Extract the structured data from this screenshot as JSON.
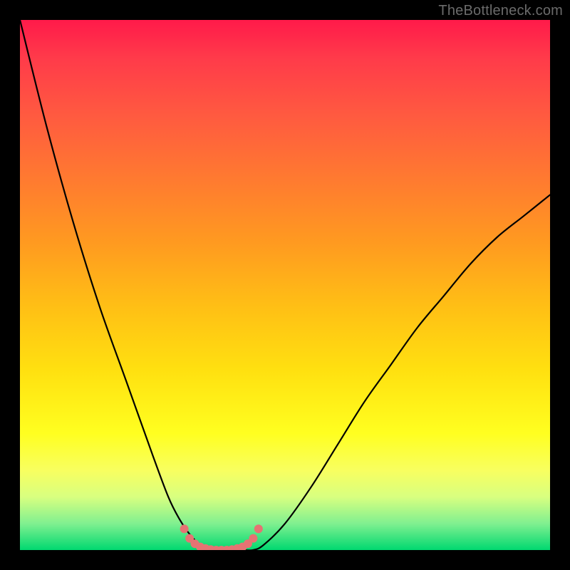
{
  "watermark": "TheBottleneck.com",
  "chart_data": {
    "type": "line",
    "title": "",
    "xlabel": "",
    "ylabel": "",
    "xlim": [
      0,
      100
    ],
    "ylim": [
      0,
      100
    ],
    "x": [
      0,
      5,
      10,
      15,
      20,
      25,
      28,
      30,
      32,
      34,
      36,
      38,
      40,
      42,
      44,
      46,
      50,
      55,
      60,
      65,
      70,
      75,
      80,
      85,
      90,
      95,
      100
    ],
    "y": [
      100,
      80,
      62,
      46,
      32,
      18,
      10,
      6,
      3,
      1,
      0,
      0,
      0,
      0,
      0,
      1,
      5,
      12,
      20,
      28,
      35,
      42,
      48,
      54,
      59,
      63,
      67
    ],
    "annotations": [],
    "markers": {
      "type": "dot-cluster-near-trough",
      "color": "#e57373",
      "x": [
        31,
        32,
        33,
        34,
        35,
        36,
        37,
        38,
        39,
        40,
        41,
        42,
        43,
        44,
        45
      ],
      "y": [
        4,
        2.2,
        1.2,
        0.6,
        0.3,
        0.1,
        0,
        0,
        0,
        0.1,
        0.3,
        0.6,
        1.2,
        2.2,
        4
      ]
    }
  }
}
